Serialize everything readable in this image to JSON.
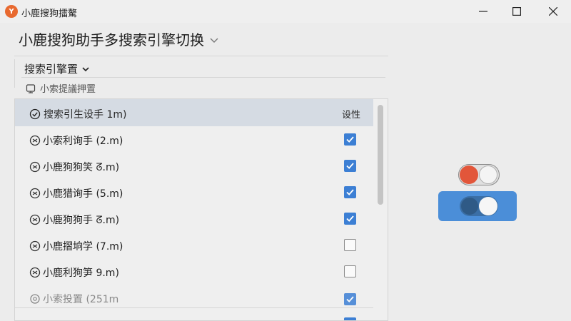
{
  "window": {
    "title": "小鹿搜狗擂驁",
    "icon_label": "Y"
  },
  "header": {
    "title": "小鹿搜狗助手多搜索引擎切换"
  },
  "section": {
    "dropdown_label": "搜索引擎置",
    "subline": "小索提議押置"
  },
  "list": {
    "header_name": "搜索引生设手 1m)",
    "header_setting": "设性",
    "rows": [
      {
        "label": "小索利询手 (2.m)",
        "checked": true
      },
      {
        "label": "小鹿狗狗笑 ᘔ.m)",
        "checked": true
      },
      {
        "label": "小鹿猎询手 (5.m)",
        "checked": true
      },
      {
        "label": "小鹿狗狗手 ᘔ.m)",
        "checked": true
      },
      {
        "label": "小鹿摺垧学 (7.m)",
        "checked": false
      },
      {
        "label": "小鹿利狗笋 9.m)",
        "checked": false
      },
      {
        "label": "小索投置 (251m",
        "checked": true
      }
    ]
  },
  "toggles": {
    "toggle1_state": "on",
    "toggle2_state": "on"
  },
  "colors": {
    "accent": "#3c7fd4",
    "toggle_red": "#e2563a",
    "highlight_row": "#d5dbe3"
  }
}
